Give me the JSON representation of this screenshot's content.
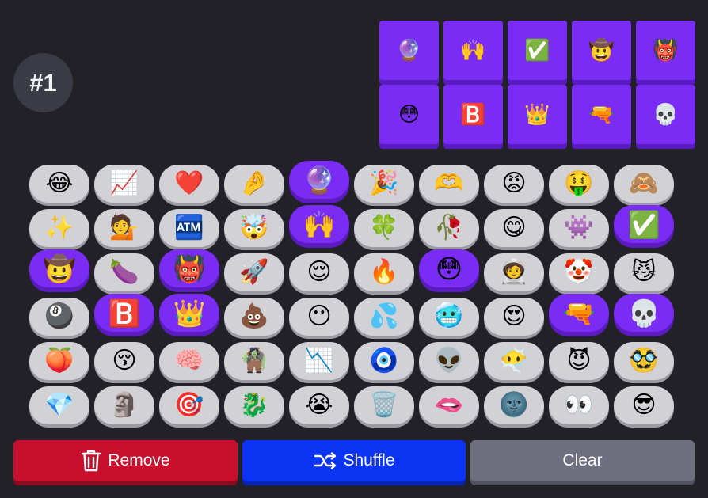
{
  "badge": {
    "label": "#1"
  },
  "selected": [
    {
      "name": "crystal-ball-icon",
      "emoji": "🔮"
    },
    {
      "name": "raising-hands-icon",
      "emoji": "🙌"
    },
    {
      "name": "check-mark-button-icon",
      "emoji": "✅"
    },
    {
      "name": "cowboy-face-icon",
      "emoji": "🤠"
    },
    {
      "name": "ogre-icon",
      "emoji": "👹"
    },
    {
      "name": "flushed-face-icon",
      "emoji": "😳"
    },
    {
      "name": "b-button-icon",
      "emoji": "🅱️"
    },
    {
      "name": "crown-icon",
      "emoji": "👑"
    },
    {
      "name": "water-pistol-icon",
      "emoji": "🔫"
    },
    {
      "name": "skull-icon",
      "emoji": "💀"
    }
  ],
  "emojis": [
    {
      "name": "face-with-tears-of-joy-icon",
      "emoji": "😂",
      "selected": false
    },
    {
      "name": "chart-increasing-icon",
      "emoji": "📈",
      "selected": false
    },
    {
      "name": "red-heart-icon",
      "emoji": "❤️",
      "selected": false
    },
    {
      "name": "pinching-hand-icon",
      "emoji": "🤌",
      "selected": false
    },
    {
      "name": "crystal-ball-icon",
      "emoji": "🔮",
      "selected": true
    },
    {
      "name": "party-popper-icon",
      "emoji": "🎉",
      "selected": false
    },
    {
      "name": "heart-hands-icon",
      "emoji": "🫶",
      "selected": false
    },
    {
      "name": "angry-face-icon",
      "emoji": "😡",
      "selected": false
    },
    {
      "name": "money-mouth-face-icon",
      "emoji": "🤑",
      "selected": false
    },
    {
      "name": "see-no-evil-monkey-icon",
      "emoji": "🙈",
      "selected": false
    },
    {
      "name": "sparkles-icon",
      "emoji": "✨",
      "selected": false
    },
    {
      "name": "person-tipping-hand-icon",
      "emoji": "💁",
      "selected": false
    },
    {
      "name": "atm-sign-icon",
      "emoji": "🏧",
      "selected": false
    },
    {
      "name": "exploding-head-icon",
      "emoji": "🤯",
      "selected": false
    },
    {
      "name": "raising-hands-icon",
      "emoji": "🙌",
      "selected": true
    },
    {
      "name": "four-leaf-clover-icon",
      "emoji": "🍀",
      "selected": false
    },
    {
      "name": "wilted-flower-icon",
      "emoji": "🥀",
      "selected": false
    },
    {
      "name": "face-savoring-food-icon",
      "emoji": "😋",
      "selected": false
    },
    {
      "name": "alien-monster-icon",
      "emoji": "👾",
      "selected": false
    },
    {
      "name": "check-mark-button-icon",
      "emoji": "✅",
      "selected": true
    },
    {
      "name": "cowboy-face-icon",
      "emoji": "🤠",
      "selected": true
    },
    {
      "name": "eggplant-icon",
      "emoji": "🍆",
      "selected": false
    },
    {
      "name": "ogre-icon",
      "emoji": "👹",
      "selected": true
    },
    {
      "name": "rocket-icon",
      "emoji": "🚀",
      "selected": false
    },
    {
      "name": "relieved-face-icon",
      "emoji": "😌",
      "selected": false
    },
    {
      "name": "fire-icon",
      "emoji": "🔥",
      "selected": false
    },
    {
      "name": "flushed-face-icon",
      "emoji": "😳",
      "selected": true
    },
    {
      "name": "astronaut-icon",
      "emoji": "🧑‍🚀",
      "selected": false
    },
    {
      "name": "clown-face-icon",
      "emoji": "🤡",
      "selected": false
    },
    {
      "name": "cat-face-icon",
      "emoji": "😼",
      "selected": false
    },
    {
      "name": "pool-8-ball-icon",
      "emoji": "🎱",
      "selected": false
    },
    {
      "name": "b-button-icon",
      "emoji": "🅱️",
      "selected": true
    },
    {
      "name": "crown-icon",
      "emoji": "👑",
      "selected": true
    },
    {
      "name": "pile-of-poo-icon",
      "emoji": "💩",
      "selected": false
    },
    {
      "name": "face-without-mouth-icon",
      "emoji": "😶",
      "selected": false
    },
    {
      "name": "sweat-droplets-icon",
      "emoji": "💦",
      "selected": false
    },
    {
      "name": "cold-face-icon",
      "emoji": "🥶",
      "selected": false
    },
    {
      "name": "smiling-face-with-heart-eyes-icon",
      "emoji": "😍",
      "selected": false
    },
    {
      "name": "water-pistol-icon",
      "emoji": "🔫",
      "selected": true
    },
    {
      "name": "skull-icon",
      "emoji": "💀",
      "selected": true
    },
    {
      "name": "peach-icon",
      "emoji": "🍑",
      "selected": false
    },
    {
      "name": "kissing-face-icon",
      "emoji": "😚",
      "selected": false
    },
    {
      "name": "brain-icon",
      "emoji": "🧠",
      "selected": false
    },
    {
      "name": "troll-icon",
      "emoji": "🧌",
      "selected": false
    },
    {
      "name": "chart-decreasing-icon",
      "emoji": "📉",
      "selected": false
    },
    {
      "name": "nazar-amulet-icon",
      "emoji": "🧿",
      "selected": false
    },
    {
      "name": "alien-icon",
      "emoji": "👽",
      "selected": false
    },
    {
      "name": "face-in-clouds-icon",
      "emoji": "😶‍🌫️",
      "selected": false
    },
    {
      "name": "smiling-face-with-horns-icon",
      "emoji": "😈",
      "selected": false
    },
    {
      "name": "disguised-face-icon",
      "emoji": "🥸",
      "selected": false
    },
    {
      "name": "gem-stone-icon",
      "emoji": "💎",
      "selected": false
    },
    {
      "name": "moai-icon",
      "emoji": "🗿",
      "selected": false
    },
    {
      "name": "direct-hit-icon",
      "emoji": "🎯",
      "selected": false
    },
    {
      "name": "dragon-icon",
      "emoji": "🐉",
      "selected": false
    },
    {
      "name": "loudly-crying-face-icon",
      "emoji": "😭",
      "selected": false
    },
    {
      "name": "wastebasket-icon",
      "emoji": "🗑️",
      "selected": false
    },
    {
      "name": "biting-lip-icon",
      "emoji": "🫦",
      "selected": false
    },
    {
      "name": "new-moon-face-icon",
      "emoji": "🌚",
      "selected": false
    },
    {
      "name": "eyes-icon",
      "emoji": "👀",
      "selected": false
    },
    {
      "name": "smiling-face-with-sunglasses-icon",
      "emoji": "😎",
      "selected": false
    }
  ],
  "buttons": {
    "remove": "Remove",
    "shuffle": "Shuffle",
    "clear": "Clear"
  },
  "colors": {
    "background": "#222127",
    "selected": "#7a2cf5",
    "remove": "#c8102e",
    "shuffle": "#0a34f2",
    "clear": "#6e7080"
  }
}
